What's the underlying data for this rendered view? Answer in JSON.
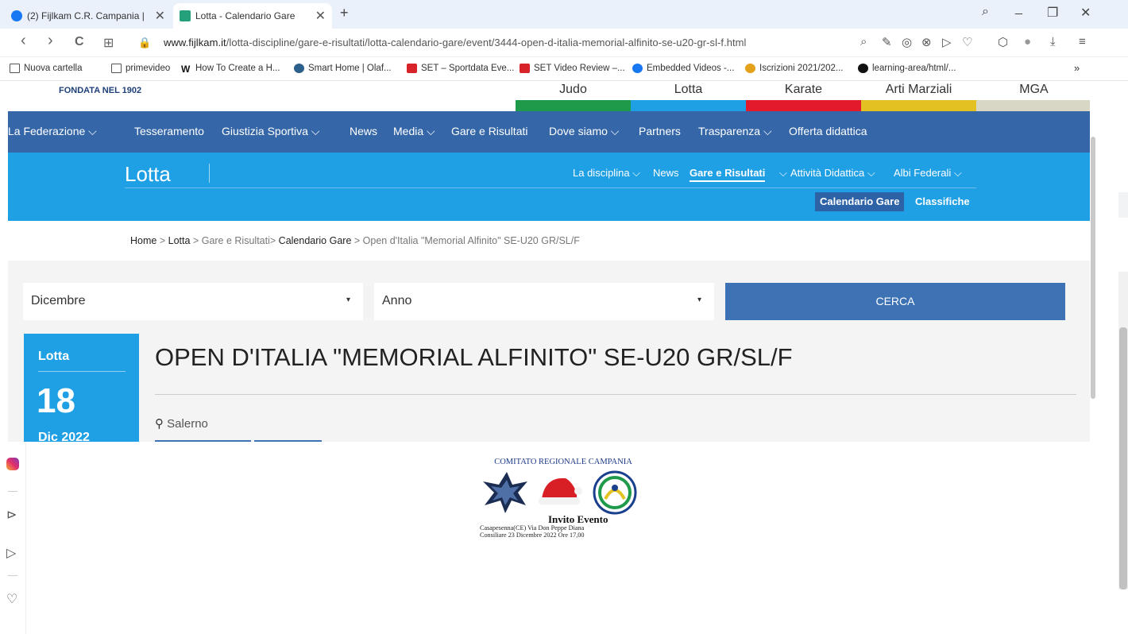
{
  "browser": {
    "tabs": [
      {
        "title": "(2) Fijlkam C.R. Campania |",
        "active": false
      },
      {
        "title": "Lotta - Calendario Gare",
        "active": true
      }
    ],
    "new_tab": "+",
    "close": "✕",
    "window_controls": {
      "search": "⌕",
      "minimize": "_",
      "restore": "❐",
      "close": "✕"
    },
    "nav": {
      "back": "‹",
      "forward": "›",
      "reload": "C",
      "speed_dial": "⊞",
      "lock": "🔒"
    },
    "url_host": "www.fijlkam.it",
    "url_path": "/lotta-discipline/gare-e-risultati/lotta-calendario-gare/event/3444-open-d-italia-memorial-alfinito-se-u20-gr-sl-f.html",
    "toolbar_icons": [
      "⌕",
      "✎",
      "◎",
      "⊗",
      "▷",
      "♡",
      "⬡",
      "●",
      "⤓",
      "≡"
    ]
  },
  "bookmarks": [
    "Nuova cartella",
    "primevideo",
    "How To Create a H...",
    "Smart Home | Olaf...",
    "SET – Sportdata Eve...",
    "SET Video Review –...",
    "Embedded Videos -...",
    "Iscrizioni 2021/202...",
    "learning-area/html/..."
  ],
  "bookmarks_more": "»",
  "site": {
    "founded": "FONDATA NEL 1902",
    "disciplines": [
      {
        "label": "Judo",
        "color": "#1f9a4b"
      },
      {
        "label": "Lotta",
        "color": "#1f9fe4"
      },
      {
        "label": "Karate",
        "color": "#e3192c"
      },
      {
        "label": "Arti Marziali",
        "color": "#e4c122"
      },
      {
        "label": "MGA",
        "color": "#d8d6c4"
      }
    ],
    "main_nav": [
      "La Federazione ⌵",
      "Tesseramento",
      "Giustizia Sportiva ⌵",
      "News",
      "Media ⌵",
      "Gare e Risultati",
      "Dove siamo ⌵",
      "Partners",
      "Trasparenza ⌵",
      "Offerta didattica"
    ],
    "section_title": "Lotta",
    "sub_nav": [
      "La disciplina ⌵",
      "News",
      "Gare e Risultati",
      "Attività Didattica ⌵",
      "Albi Federali ⌵"
    ],
    "sub_nav_caret": "⌵",
    "pills": [
      "Calendario Gare",
      "Classifiche"
    ],
    "breadcrumb": {
      "home": "Home",
      "sep": ">",
      "lotta": "Lotta",
      "gare": "Gare e Risultati",
      "calendario": "Calendario Gare",
      "current": "Open d'Italia \"Memorial Alfinito\" SE-U20 GR/SL/F"
    },
    "filters": {
      "month": "Dicembre",
      "year": "Anno",
      "caret": "▾",
      "search_label": "CERCA"
    },
    "event": {
      "category": "Lotta",
      "day": "18",
      "month_year": "Dic 2022",
      "title": "OPEN D'ITALIA \"MEMORIAL ALFINITO\" SE-U20 GR/SL/F",
      "location": "Salerno",
      "pin": "⚲"
    }
  },
  "invite_image": {
    "org": "COMITATO REGIONALE CAMPANIA",
    "heading": "Invito Evento",
    "line1": "Casapesenna(CE) Via Don Peppe Diana",
    "line2": "Consiliare 23 Dicembre 2022 Ore 17,00"
  },
  "sidebar_icons": [
    "instagram-icon",
    "play-icon",
    "send-icon",
    "heart-icon"
  ]
}
